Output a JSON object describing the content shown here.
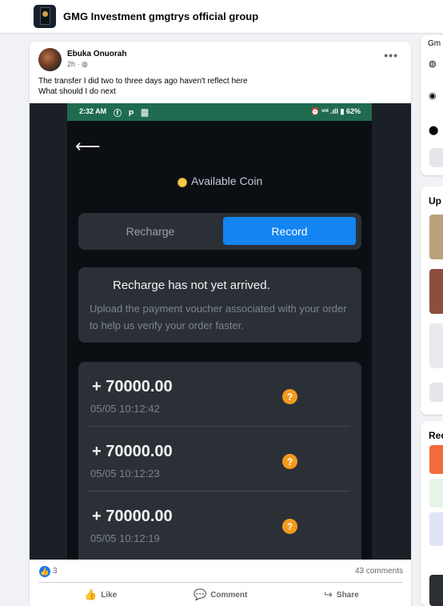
{
  "header": {
    "group_name": "GMG Investment gmgtrys official group"
  },
  "post": {
    "author": "Ebuka Onuorah",
    "time": "2h",
    "time_suffix": "·",
    "text_line1": "The transfer I did two to three days ago haven't reflect here",
    "text_line2": "What should I do next",
    "menu_label": "•••"
  },
  "phone_screenshot": {
    "status_bar": {
      "time": "2:32 AM",
      "icons": "ⓕ P ▦",
      "right": "⏰ ᵛᵒˡ .ıll ▮ 62%"
    },
    "available_coin_label": "Available Coin",
    "tabs": {
      "recharge": "Recharge",
      "record": "Record"
    },
    "notice": {
      "title": "Recharge has not yet arrived.",
      "body": "Upload the payment voucher associated with your order to help us verify your order faster."
    },
    "records": [
      {
        "amount": "+ 70000.00",
        "time": "05/05 10:12:42",
        "help": "?"
      },
      {
        "amount": "+ 70000.00",
        "time": "05/05 10:12:23",
        "help": "?"
      },
      {
        "amount": "+ 70000.00",
        "time": "05/05 10:12:19",
        "help": "?"
      }
    ]
  },
  "engagement": {
    "reactions": "3",
    "comments": "43 comments"
  },
  "actions": {
    "like": "Like",
    "comment": "Comment",
    "share": "Share"
  },
  "sidebar": {
    "about_cut": "Gm",
    "media_cut": "Up",
    "recent_cut": "Rec"
  },
  "colors": {
    "accent": "#1877f2",
    "status_bar": "#1f6b50",
    "record_tab": "#1484f3",
    "help_badge": "#f39a1e"
  }
}
